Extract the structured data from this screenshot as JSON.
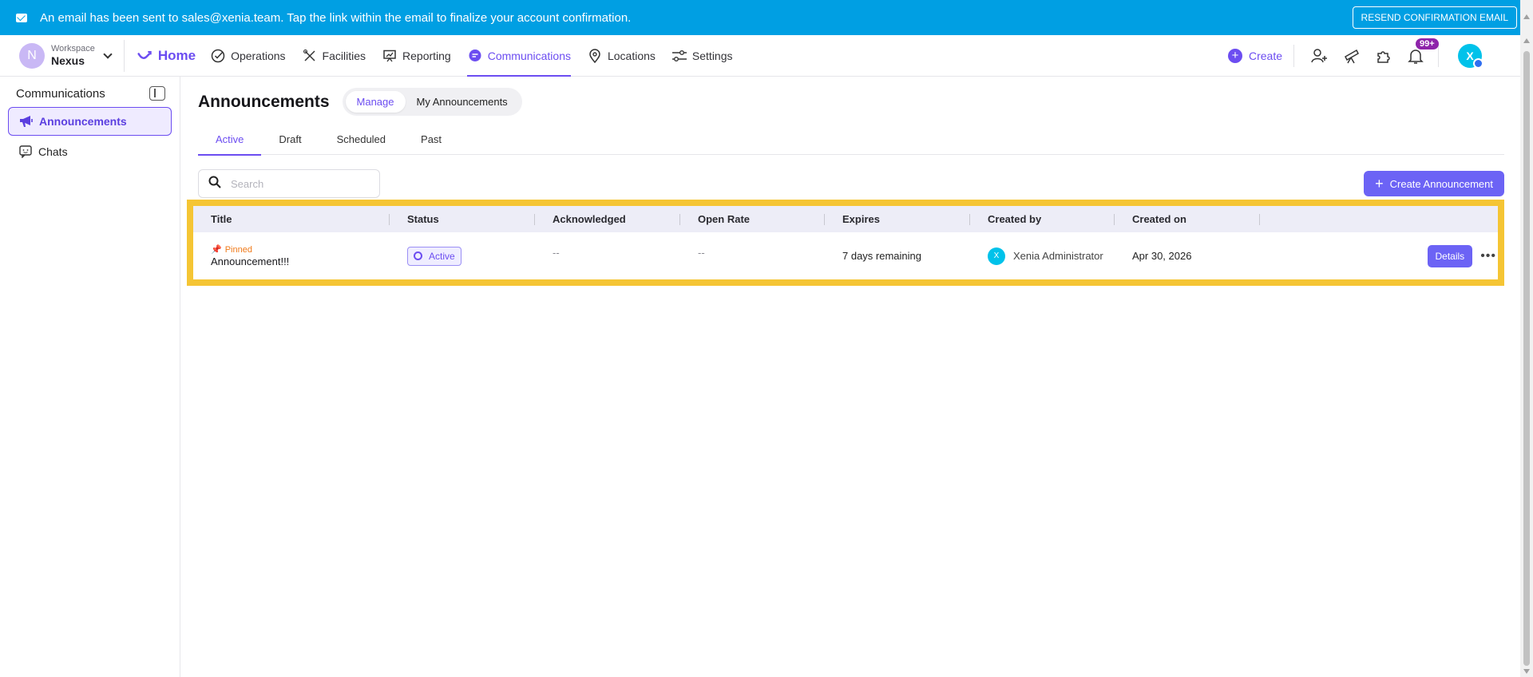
{
  "banner": {
    "message": "An email has been sent to sales@xenia.team. Tap the link within the email to finalize your account confirmation.",
    "resend_label": "RESEND CONFIRMATION EMAIL"
  },
  "workspace": {
    "initial": "N",
    "label": "Workspace",
    "name": "Nexus"
  },
  "nav": {
    "home": "Home",
    "items": [
      "Operations",
      "Facilities",
      "Reporting",
      "Communications",
      "Locations",
      "Settings"
    ],
    "active": "Communications",
    "create_label": "Create",
    "notification_count": "99+",
    "user_initial": "X"
  },
  "sidebar": {
    "title": "Communications",
    "items": [
      {
        "label": "Announcements",
        "icon": "megaphone-icon",
        "active": true
      },
      {
        "label": "Chats",
        "icon": "chat-icon",
        "active": false
      }
    ]
  },
  "page": {
    "title": "Announcements",
    "segments": [
      "Manage",
      "My Announcements"
    ],
    "tabs": [
      "Active",
      "Draft",
      "Scheduled",
      "Past"
    ],
    "search_placeholder": "Search",
    "create_button": "Create Announcement"
  },
  "table": {
    "columns": [
      "Title",
      "Status",
      "Acknowledged",
      "Open Rate",
      "Expires",
      "Created by",
      "Created on"
    ],
    "rows": [
      {
        "pinned_label": "Pinned",
        "title": "Announcement!!!",
        "status": "Active",
        "acknowledged": "--",
        "open_rate": "--",
        "expires": "7 days remaining",
        "created_by_initial": "X",
        "created_by": "Xenia Administrator",
        "created_on": "Apr 30, 2026",
        "details_label": "Details",
        "more_label": "•••"
      }
    ]
  },
  "colors": {
    "accent": "#6c4df1",
    "banner": "#009fe3",
    "highlight": "#f5c534",
    "pinned": "#f07a1a"
  }
}
